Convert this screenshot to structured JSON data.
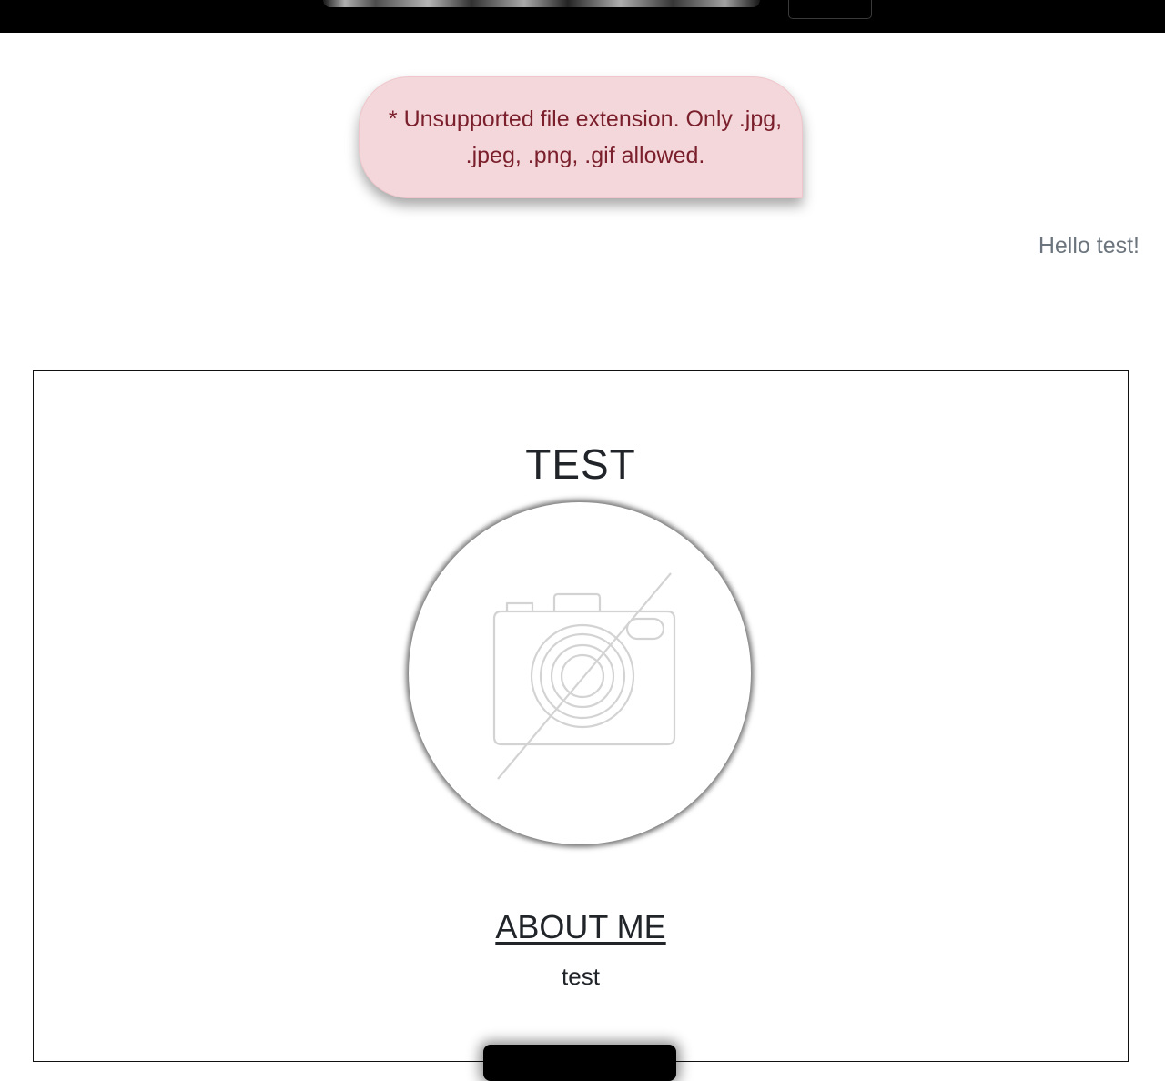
{
  "header": {
    "logo_icon": "site-logo",
    "menu_icon": "menu-toggle-icon"
  },
  "alert": {
    "message": "* Unsupported file extension. Only .jpg, .jpeg, .png, .gif allowed.",
    "colors": {
      "background": "#f3d7da",
      "text": "#7a1f2b"
    }
  },
  "greeting": {
    "text": "Hello test!"
  },
  "profile": {
    "name": "TEST",
    "avatar_icon": "no-photo-camera-icon",
    "about_heading": "ABOUT ME",
    "about_text": "test",
    "action_button_label": ""
  }
}
